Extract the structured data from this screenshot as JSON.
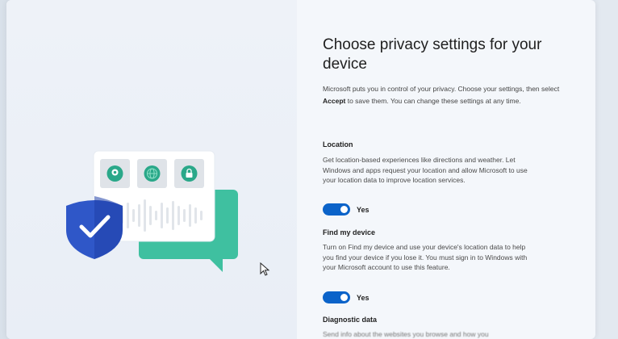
{
  "title": "Choose privacy settings for your device",
  "intro": {
    "text_before": "Microsoft puts you in control of your privacy. Choose your settings, then select ",
    "accept_word": "Accept",
    "text_after": " to save them. You can change these settings at any time."
  },
  "location": {
    "heading": "Location",
    "description": "Get location-based experiences like directions and weather. Let Windows and apps request your location and allow Microsoft to use your location data to improve location services.",
    "toggle_label": "Yes"
  },
  "find_my_device": {
    "heading": "Find my device",
    "description": "Turn on Find my device and use your device's location data to help you find your device if you lose it. You must sign in to Windows with your Microsoft account to use this feature.",
    "toggle_label": "Yes"
  },
  "diagnostic": {
    "heading": "Diagnostic data",
    "description_partial": "Send info about the websites you browse and how you"
  },
  "colors": {
    "accent": "#0b63c9",
    "shield": "#2f57c8",
    "chat_bubble": "#3fc0a0",
    "icon_green": "#2aa889"
  },
  "icons": [
    "location-pin-icon",
    "globe-icon",
    "lock-icon",
    "shield-check-icon",
    "cursor-icon"
  ]
}
